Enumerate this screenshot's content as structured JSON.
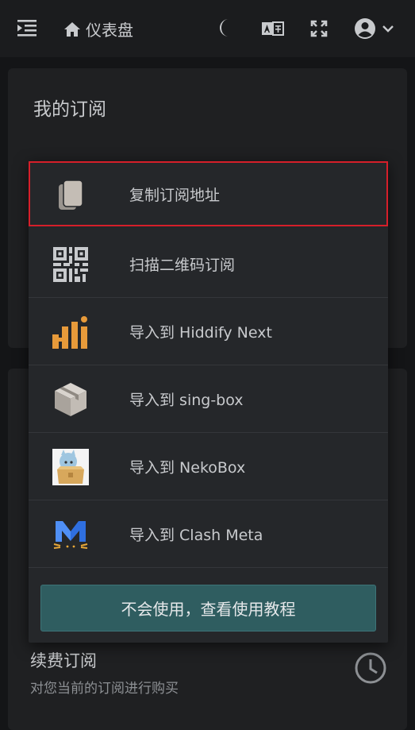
{
  "header": {
    "breadcrumb": "仪表盘"
  },
  "card": {
    "title": "我的订阅"
  },
  "menu": {
    "items": [
      {
        "label": "复制订阅地址",
        "icon": "copy-icon"
      },
      {
        "label": "扫描二维码订阅",
        "icon": "qr-code-icon"
      },
      {
        "label": "导入到 Hiddify Next",
        "icon": "hiddify-logo-icon"
      },
      {
        "label": "导入到 sing-box",
        "icon": "sing-box-logo-icon"
      },
      {
        "label": "导入到 NekoBox",
        "icon": "nekobox-logo-icon"
      },
      {
        "label": "导入到 Clash Meta",
        "icon": "clash-meta-logo-icon"
      }
    ],
    "help_button": "不会使用，查看使用教程"
  },
  "renew": {
    "title": "续费订阅",
    "description": "对您当前的订阅进行购买"
  },
  "colors": {
    "background": "#141517",
    "panel": "#25272a",
    "accent": "#2f5d60",
    "highlight_border": "#d61f2a",
    "hiddify_orange": "#e79a3a",
    "clash_blue": "#2f6fe0"
  }
}
